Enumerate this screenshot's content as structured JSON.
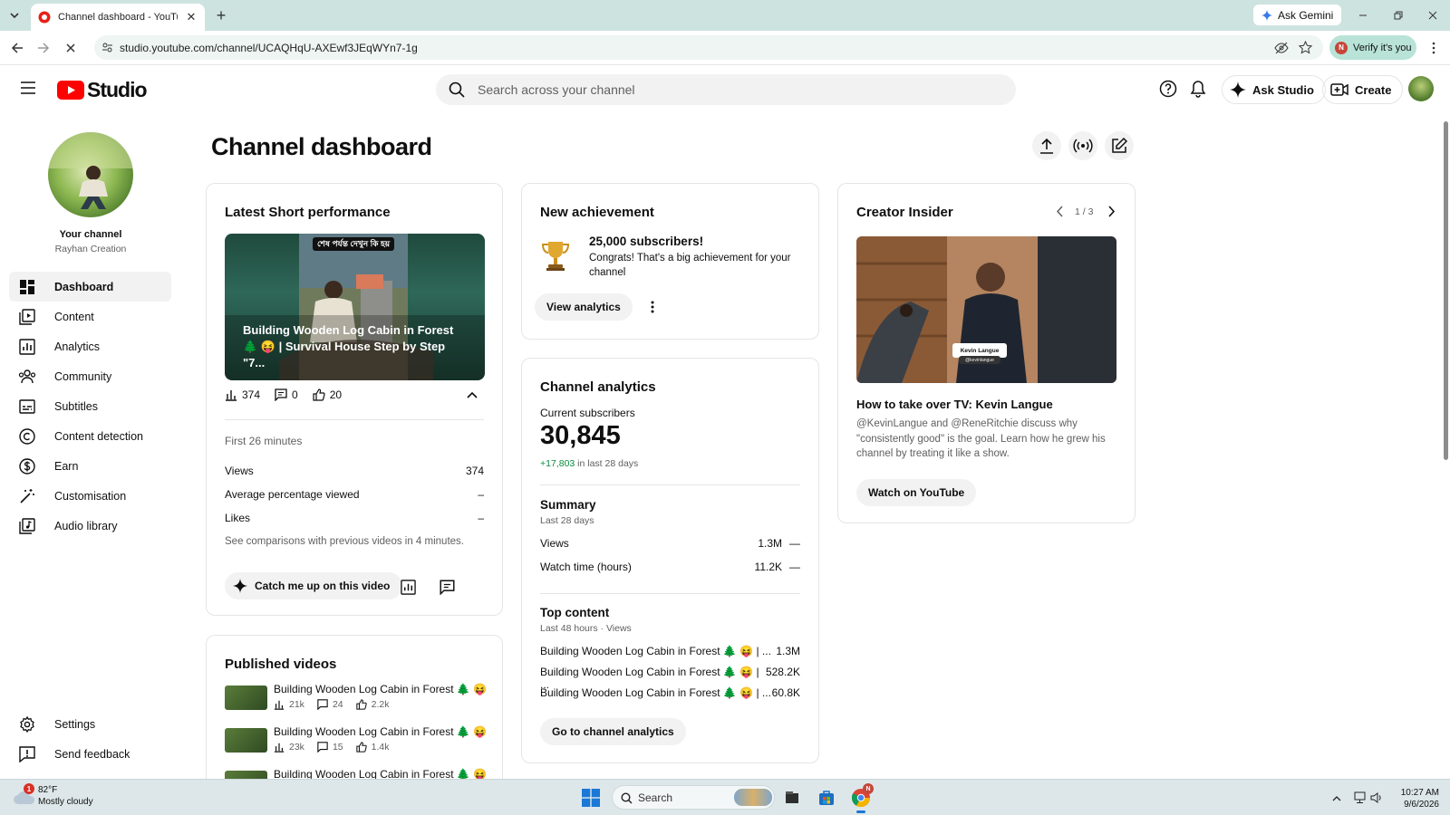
{
  "browser": {
    "tab_title": "Channel dashboard - YouTube S",
    "url": "studio.youtube.com/channel/UCAQHqU-AXEwf3JEqWYn7-1g",
    "ask_gemini": "Ask Gemini",
    "verify": "Verify it's you",
    "profile_initial": "N"
  },
  "header": {
    "logo_text": "Studio",
    "search_placeholder": "Search across your channel",
    "ask_studio": "Ask Studio",
    "create": "Create"
  },
  "sidebar": {
    "channel_label": "Your channel",
    "channel_name": "Rayhan Creation",
    "items": [
      {
        "label": "Dashboard",
        "icon": "dashboard-icon"
      },
      {
        "label": "Content",
        "icon": "content-icon"
      },
      {
        "label": "Analytics",
        "icon": "analytics-icon"
      },
      {
        "label": "Community",
        "icon": "community-icon"
      },
      {
        "label": "Subtitles",
        "icon": "subtitles-icon"
      },
      {
        "label": "Content detection",
        "icon": "copyright-icon"
      },
      {
        "label": "Earn",
        "icon": "dollar-icon"
      },
      {
        "label": "Customisation",
        "icon": "magic-wand-icon"
      },
      {
        "label": "Audio library",
        "icon": "audio-library-icon"
      }
    ],
    "settings": "Settings",
    "feedback": "Send feedback"
  },
  "page": {
    "title": "Channel dashboard"
  },
  "short_perf": {
    "title": "Latest Short performance",
    "thumb_banner": "শেষ পর্যন্ত দেখুন কি হয়",
    "video_title": "Building Wooden Log Cabin in Forest 🌲 😝 | Survival House Step by Step \"7...",
    "views": "374",
    "comments": "0",
    "likes": "20",
    "period": "First 26 minutes",
    "rows": [
      {
        "label": "Views",
        "value": "374"
      },
      {
        "label": "Average percentage viewed",
        "value": "–"
      },
      {
        "label": "Likes",
        "value": "–"
      }
    ],
    "note": "See comparisons with previous videos in 4 minutes.",
    "catch_me_up": "Catch me up on this video"
  },
  "published": {
    "title": "Published videos",
    "videos": [
      {
        "title": "Building Wooden Log Cabin in Forest 🌲 😝 ...",
        "views": "21k",
        "comments": "24",
        "likes": "2.2k"
      },
      {
        "title": "Building Wooden Log Cabin in Forest 🌲 😝 ...",
        "views": "23k",
        "comments": "15",
        "likes": "1.4k"
      },
      {
        "title": "Building Wooden Log Cabin in Forest 🌲 😝 ..."
      }
    ]
  },
  "achievement": {
    "title": "New achievement",
    "headline": "25,000 subscribers!",
    "text": "Congrats! That's a big achievement for your channel",
    "button": "View analytics"
  },
  "analytics": {
    "title": "Channel analytics",
    "subs_label": "Current subscribers",
    "subs_value": "30,845",
    "subs_delta": "+17,803",
    "subs_delta_suffix": "in last 28 days",
    "summary_title": "Summary",
    "summary_period": "Last 28 days",
    "summary_rows": [
      {
        "label": "Views",
        "value": "1.3M",
        "trend": "—"
      },
      {
        "label": "Watch time (hours)",
        "value": "11.2K",
        "trend": "—"
      }
    ],
    "top_title": "Top content",
    "top_period": "Last 48 hours · Views",
    "top_rows": [
      {
        "label": "Building Wooden Log Cabin in Forest 🌲 😝 | ...",
        "value": "1.3M"
      },
      {
        "label": "Building Wooden Log Cabin in Forest 🌲 😝 | ...",
        "value": "528.2K"
      },
      {
        "label": "Building Wooden Log Cabin in Forest 🌲 😝 | ...",
        "value": "60.8K"
      }
    ],
    "button": "Go to channel analytics"
  },
  "insider": {
    "title": "Creator Insider",
    "pager": "1 / 3",
    "name_tag": "Kevin Langue",
    "name_tag_handle": "@kevinlangue",
    "video_title": "How to take over TV: Kevin Langue",
    "desc": "@KevinLangue and @ReneRitchie discuss why \"consistently good\" is the goal. Learn how he grew his channel by treating it like a show.",
    "button": "Watch on YouTube"
  },
  "taskbar": {
    "badge": "1",
    "temp": "82°F",
    "weather": "Mostly cloudy",
    "search": "Search",
    "chrome_badge": "N",
    "time": "10:27 AM",
    "date": "9/6/2026"
  },
  "colors": {
    "accent_red": "#ff0000",
    "positive_green": "#0c8a3f"
  }
}
